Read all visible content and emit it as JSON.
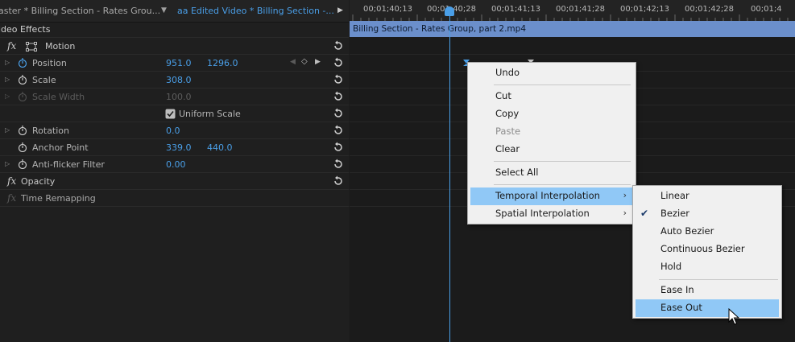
{
  "tabs": {
    "master": "aster * Billing Section - Rates Grou...",
    "edited": "aa Edited Video * Billing Section -..."
  },
  "effects": {
    "section_title": "ideo Effects",
    "motion": "Motion",
    "position": {
      "label": "Position",
      "x": "951.0",
      "y": "1296.0"
    },
    "scale": {
      "label": "Scale",
      "value": "308.0"
    },
    "scale_width": {
      "label": "Scale Width",
      "value": "100.0"
    },
    "uniform_scale": "Uniform Scale",
    "rotation": {
      "label": "Rotation",
      "value": "0.0"
    },
    "anchor_point": {
      "label": "Anchor Point",
      "x": "339.0",
      "y": "440.0"
    },
    "anti_flicker": {
      "label": "Anti-flicker Filter",
      "value": "0.00"
    },
    "opacity": "Opacity",
    "time_remapping": "Time Remapping",
    "fx": "fx"
  },
  "timeline": {
    "timecodes": [
      "00;01;40;13",
      "00;01;40;28",
      "00;01;41;13",
      "00;01;41;28",
      "00;01;42;13",
      "00;01;42;28",
      "00;01;4"
    ],
    "clip_name": "Billing Section - Rates Group, part 2.mp4"
  },
  "context_menu": {
    "undo": "Undo",
    "cut": "Cut",
    "copy": "Copy",
    "paste": "Paste",
    "clear": "Clear",
    "select_all": "Select All",
    "temporal": "Temporal Interpolation",
    "spatial": "Spatial Interpolation"
  },
  "submenu": {
    "linear": "Linear",
    "bezier": "Bezier",
    "auto_bezier": "Auto Bezier",
    "continuous_bezier": "Continuous Bezier",
    "hold": "Hold",
    "ease_in": "Ease In",
    "ease_out": "Ease Out"
  },
  "colors": {
    "accent_blue": "#4a9fe8",
    "clip_bar": "#6b8fcb",
    "menu_highlight": "#90c8f6"
  }
}
